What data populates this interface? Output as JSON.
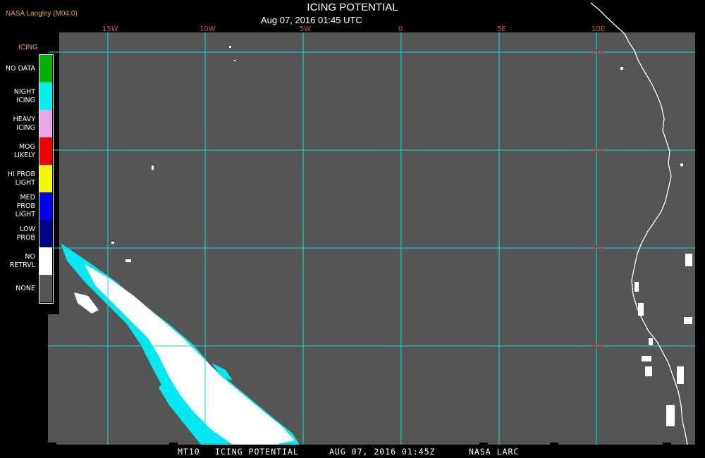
{
  "header": {
    "credit": "NASA Langley (M04.0)",
    "title": "ICING POTENTIAL",
    "subtitle": "Aug 07, 2016 01:45 UTC"
  },
  "map": {
    "background_color": "#555555",
    "grid_color": "#00e0e0",
    "coast_color": "#ffffff",
    "longitude_labels": [
      "15W",
      "10W",
      "5W",
      "0",
      "5E",
      "10E"
    ],
    "latitude_labels": [
      "15S",
      "20S",
      "25S",
      "30S"
    ],
    "lon_label_color": "#e05030",
    "lat_label_color": "#e05030"
  },
  "legend": {
    "title": "ICING",
    "items": [
      {
        "label": "NO DATA",
        "color": "#00b000"
      },
      {
        "label": "NIGHT\nICING",
        "color": "#00f0f0"
      },
      {
        "label": "HEAVY\nICING",
        "color": "#e8a8e8"
      },
      {
        "label": "MOG\nLIKELY",
        "color": "#f00000"
      },
      {
        "label": "HI PROB\nLIGHT",
        "color": "#f8f800"
      },
      {
        "label": "MED PROB\nLIGHT",
        "color": "#0000f8"
      },
      {
        "label": "LOW\nPROB",
        "color": "#000080"
      },
      {
        "label": "NO\nRETRVL",
        "color": "#ffffff"
      },
      {
        "label": "NONE",
        "color": "#555555"
      }
    ]
  },
  "footer": {
    "product": "MT10",
    "name": "ICING POTENTIAL",
    "time": "AUG 07, 2016 01:45Z",
    "org": "NASA LARC"
  }
}
